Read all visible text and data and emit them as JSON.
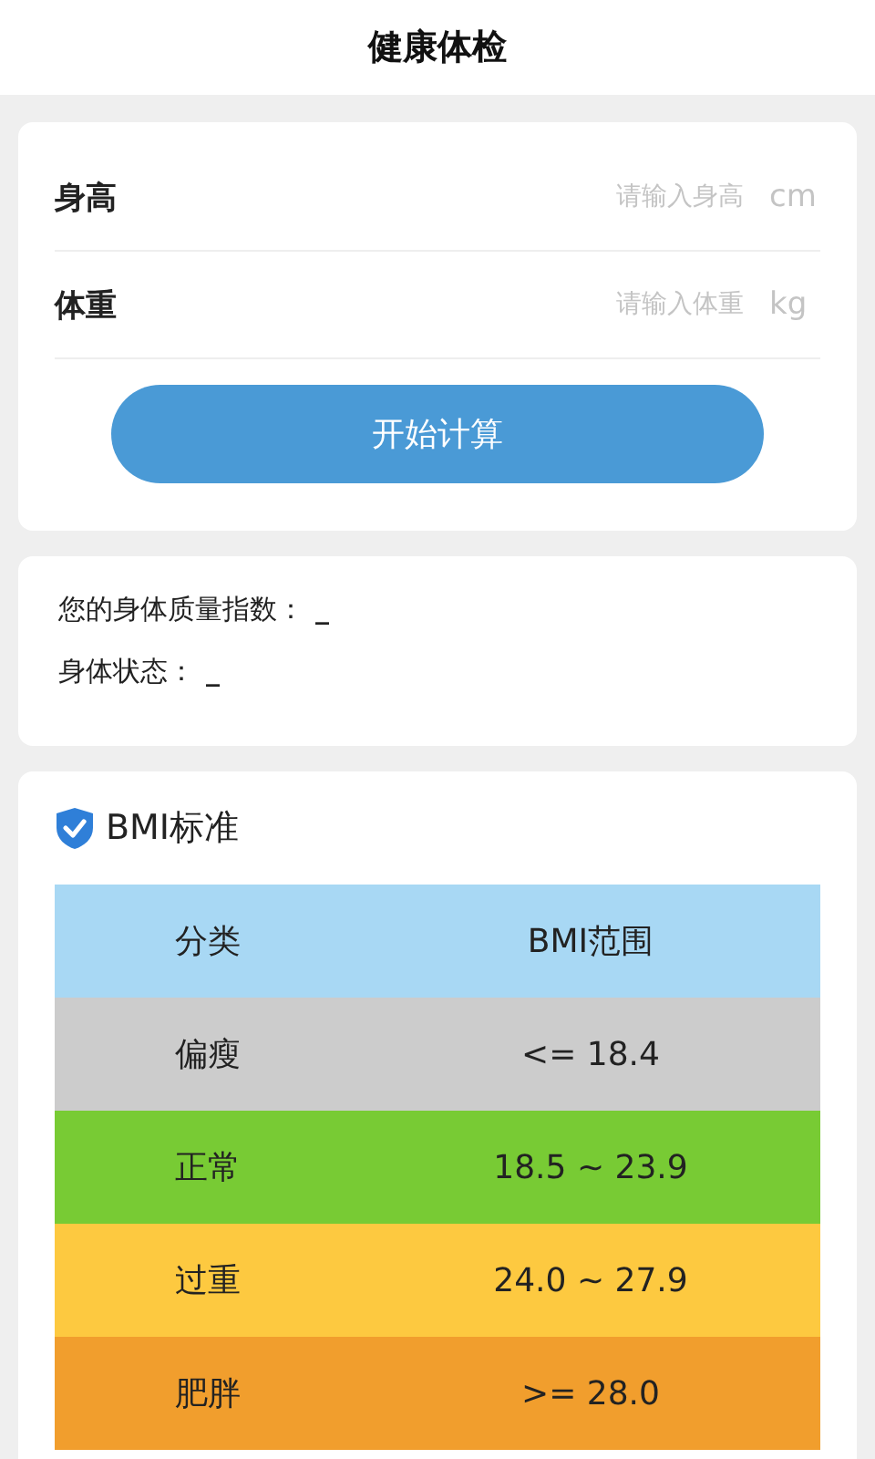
{
  "header": {
    "title": "健康体检"
  },
  "form": {
    "fields": [
      {
        "label": "身高",
        "placeholder": "请输入身高",
        "unit": "cm"
      },
      {
        "label": "体重",
        "placeholder": "请输入体重",
        "unit": "kg"
      }
    ],
    "button": "开始计算"
  },
  "result": {
    "lines": [
      {
        "label": "您的身体质量指数：",
        "value": "_"
      },
      {
        "label": "身体状态：",
        "value": "_"
      }
    ]
  },
  "standard": {
    "title": "BMI标准",
    "columns": [
      "分类",
      "BMI范围"
    ],
    "header_row": {
      "color": "#a8d8f4"
    },
    "rows": [
      {
        "category": "偏瘦",
        "range": "<= 18.4",
        "color": "#cccccc"
      },
      {
        "category": "正常",
        "range": "18.5 ~ 23.9",
        "color": "#78cb34"
      },
      {
        "category": "过重",
        "range": "24.0 ~ 27.9",
        "color": "#fdc940"
      },
      {
        "category": "肥胖",
        "range": ">= 28.0",
        "color": "#f19e2d"
      }
    ]
  }
}
